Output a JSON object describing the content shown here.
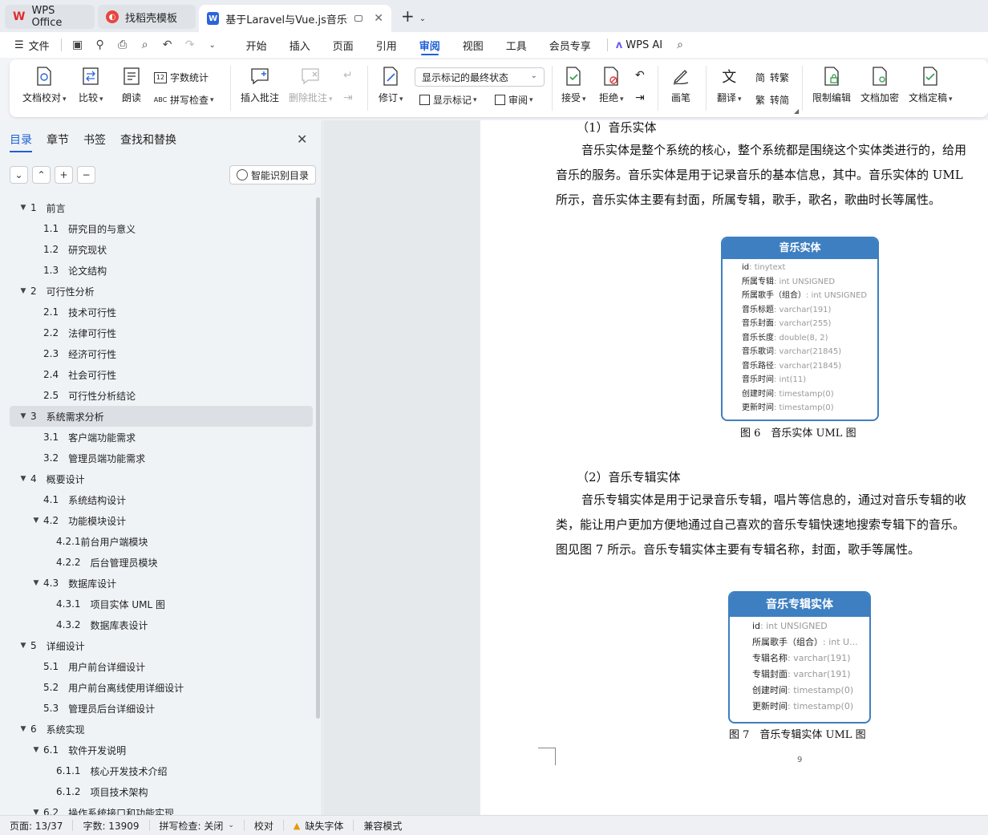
{
  "tabs": [
    {
      "label": "WPS Office",
      "icon": "wps-logo-icon",
      "color": "#e02b2b"
    },
    {
      "label": "找稻壳模板",
      "icon": "docer-icon",
      "color": "#e8453c"
    },
    {
      "label": "基于Laravel与Vue.js音乐流媒",
      "icon": "writer-icon",
      "color": "#2b65d9"
    }
  ],
  "menu": {
    "file_label": "文件",
    "items": [
      "开始",
      "插入",
      "页面",
      "引用",
      "审阅",
      "视图",
      "工具",
      "会员专享"
    ],
    "active": "审阅",
    "ai_label": "WPS AI"
  },
  "ribbon": {
    "doc_check": "文档校对",
    "compare": "比较",
    "read_aloud": "朗读",
    "word_count": "字数统计",
    "spell_check": "拼写检查",
    "insert_comment": "插入批注",
    "delete_comment": "删除批注",
    "revise": "修订",
    "markup_state": "显示标记的最终状态",
    "show_markup": "显示标记",
    "review": "审阅",
    "accept": "接受",
    "reject": "拒绝",
    "pen": "画笔",
    "translate": "翻译",
    "to_traditional": "转繁",
    "to_simplified": "转简",
    "restrict_edit": "限制编辑",
    "encrypt": "文档加密",
    "finalize": "文档定稿"
  },
  "nav": {
    "tabs": [
      "目录",
      "章节",
      "书签",
      "查找和替换"
    ],
    "smart_toc": "智能识别目录",
    "toc": [
      {
        "num": "1",
        "text": "前言",
        "level": 1,
        "tri": "▼"
      },
      {
        "num": "1.1",
        "text": "研究目的与意义",
        "level": 2
      },
      {
        "num": "1.2",
        "text": "研究现状",
        "level": 2
      },
      {
        "num": "1.3",
        "text": "论文结构",
        "level": 2
      },
      {
        "num": "2",
        "text": "可行性分析",
        "level": 1,
        "tri": "▼"
      },
      {
        "num": "2.1",
        "text": "技术可行性",
        "level": 2
      },
      {
        "num": "2.2",
        "text": "法律可行性",
        "level": 2
      },
      {
        "num": "2.3",
        "text": "经济可行性",
        "level": 2
      },
      {
        "num": "2.4",
        "text": "社会可行性",
        "level": 2
      },
      {
        "num": "2.5",
        "text": "可行性分析结论",
        "level": 2
      },
      {
        "num": "3",
        "text": "系统需求分析",
        "level": 1,
        "tri": "▼",
        "selected": true
      },
      {
        "num": "3.1",
        "text": "客户端功能需求",
        "level": 2
      },
      {
        "num": "3.2",
        "text": "管理员端功能需求",
        "level": 2
      },
      {
        "num": "4",
        "text": "概要设计",
        "level": 1,
        "tri": "▼"
      },
      {
        "num": "4.1",
        "text": "系统结构设计",
        "level": 2
      },
      {
        "num": "4.2",
        "text": "功能模块设计",
        "level": 2,
        "tri": "▼"
      },
      {
        "num": "4.2.1",
        "text": "前台用户端模块",
        "level": 3,
        "tight": true
      },
      {
        "num": "4.2.2",
        "text": "后台管理员模块",
        "level": 3
      },
      {
        "num": "4.3",
        "text": "数据库设计",
        "level": 2,
        "tri": "▼"
      },
      {
        "num": "4.3.1",
        "text": "项目实体 UML 图",
        "level": 3
      },
      {
        "num": "4.3.2",
        "text": "数据库表设计",
        "level": 3
      },
      {
        "num": "5",
        "text": "详细设计",
        "level": 1,
        "tri": "▼"
      },
      {
        "num": "5.1",
        "text": "用户前台详细设计",
        "level": 2
      },
      {
        "num": "5.2",
        "text": "用户前台离线使用详细设计",
        "level": 2
      },
      {
        "num": "5.3",
        "text": "管理员后台详细设计",
        "level": 2
      },
      {
        "num": "6",
        "text": "系统实现",
        "level": 1,
        "tri": "▼"
      },
      {
        "num": "6.1",
        "text": "软件开发说明",
        "level": 2,
        "tri": "▼"
      },
      {
        "num": "6.1.1",
        "text": "核心开发技术介绍",
        "level": 3
      },
      {
        "num": "6.1.2",
        "text": "项目技术架构",
        "level": 3
      },
      {
        "num": "6.2",
        "text": "操作系统接口和功能实现",
        "level": 2,
        "tri": "▼"
      }
    ]
  },
  "document": {
    "h1": "（1）音乐实体",
    "p1": [
      "音乐实体是整个系统的核心，整个系统都是围绕这个实体类进行的，给用",
      "音乐的服务。音乐实体是用于记录音乐的基本信息，其中。音乐实体的 UML",
      "所示，音乐实体主要有封面，所属专辑，歌手，歌名，歌曲时长等属性。"
    ],
    "uml1": {
      "title": "音乐实体",
      "fields": [
        {
          "name": "id",
          "type": ": tinytext"
        },
        {
          "name": "所属专辑",
          "type": ": int UNSIGNED"
        },
        {
          "name": "所属歌手（组合）",
          "type": ": int UNSIGNED"
        },
        {
          "name": "音乐标题",
          "type": ": varchar(191)"
        },
        {
          "name": "音乐封面",
          "type": ": varchar(255)"
        },
        {
          "name": "音乐长度",
          "type": ": double(8, 2)"
        },
        {
          "name": "音乐歌词",
          "type": ": varchar(21845)"
        },
        {
          "name": "音乐路径",
          "type": ": varchar(21845)"
        },
        {
          "name": "音乐时间",
          "type": ": int(11)"
        },
        {
          "name": "创建时间",
          "type": ": timestamp(0)"
        },
        {
          "name": "更新时间",
          "type": ": timestamp(0)"
        }
      ]
    },
    "caption1": "图 6　音乐实体  UML  图",
    "h2": "（2）音乐专辑实体",
    "p2": [
      "音乐专辑实体是用于记录音乐专辑，唱片等信息的，通过对音乐专辑的收",
      "类，能让用户更加方便地通过自己喜欢的音乐专辑快速地搜索专辑下的音乐。",
      "图见图 7 所示。音乐专辑实体主要有专辑名称，封面，歌手等属性。"
    ],
    "uml2": {
      "title": "音乐专辑实体",
      "fields": [
        {
          "name": "id",
          "type": ": int UNSIGNED"
        },
        {
          "name": "所属歌手（组合）",
          "type": ": int U..."
        },
        {
          "name": "专辑名称",
          "type": ": varchar(191)"
        },
        {
          "name": "专辑封面",
          "type": ": varchar(191)"
        },
        {
          "name": "创建时间",
          "type": ": timestamp(0)"
        },
        {
          "name": "更新时间",
          "type": ": timestamp(0)"
        }
      ]
    },
    "caption2": "图 7　音乐专辑实体  UML  图",
    "page_number": "9"
  },
  "status": {
    "page": "页面: 13/37",
    "words": "字数: 13909",
    "spell": "拼写检查: 关闭",
    "proof": "校对",
    "missing_font": "缺失字体",
    "compat": "兼容模式"
  }
}
